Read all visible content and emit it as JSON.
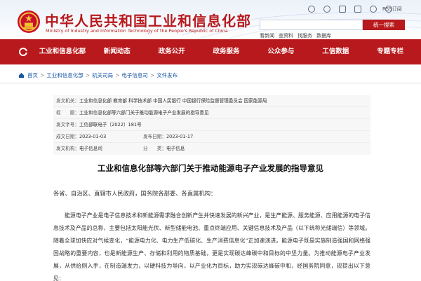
{
  "header": {
    "site_title": "中华人民共和国工业和信息化部",
    "site_title_en": "Ministry of Industry and Information Technology of the People's Republic of China",
    "rss_label": "RSS订阅",
    "search": {
      "placeholder": "",
      "button_label": "统一搜索"
    },
    "quick_links": [
      "看新闻",
      "查资料",
      "找服务",
      "数据库"
    ],
    "top_icons": [
      "wechat-icon",
      "weibo-icon",
      "mobile-icon",
      "mail-icon",
      "accessibility-icon",
      "rss-icon"
    ]
  },
  "nav": {
    "items": [
      "工业和信息化部",
      "新闻动态",
      "政务公开",
      "政务服务",
      "公众参与",
      "工信数据",
      "专题专栏"
    ]
  },
  "breadcrumb": {
    "items": [
      "首页",
      "工业和信息化部",
      "机关司局",
      "电子信息司",
      "文件发布"
    ]
  },
  "meta": {
    "issuer_label": "发文机关：",
    "issuer_value": "工业和信息化部 教育部 科学技术部 中国人民银行 中国银行保险监督管理委员会 国家能源局",
    "title_label": "标　　题：",
    "title_value": "工业和信息化部等六部门关于推动能源电子产业发展的指导意见",
    "docno_label": "发文字号：",
    "docno_value": "工信部联电子〔2022〕181号",
    "created_label": "成文日期：",
    "created_value": "2023-01-03",
    "published_label": "发布日期：",
    "published_value": "2023-01-17",
    "org_label": "发文机构：",
    "org_value": "电子信息司",
    "category_label": "分　　类：",
    "category_value": "电子信息"
  },
  "article": {
    "title": "工业和信息化部等六部门关于推动能源电子产业发展的指导意见",
    "greeting": "各省、自治区、直辖市人民政府，国务院各部委、各直属机构：",
    "body": "能源电子产业是电子信息技术和新能源需求融合创新产生并快速发展的新兴产业，是生产能源、服务能源、应用能源的电子信息技术及产品的总称，主要包括太阳能光伏、新型储能电池、重点终端应用、关键信息技术及产品（以下统称光储端信）等领域。随着全球加快应对气候变化，“能源电力化、电力生产低碳化、生产消费信息化”正加速演进。能源电子既是实施制造强国和网络强国战略的重要内容，也是新能源生产、存储和利用的物质基础，更是实现碳达峰碳中和目标的中坚力量。为推动能源电子产业发展，从供给侧入手，在制造端发力，以硬科技为导向，以产业化为目标，助力实现碳达峰碳中和，经国务院同意，现提出以下意见："
  }
}
